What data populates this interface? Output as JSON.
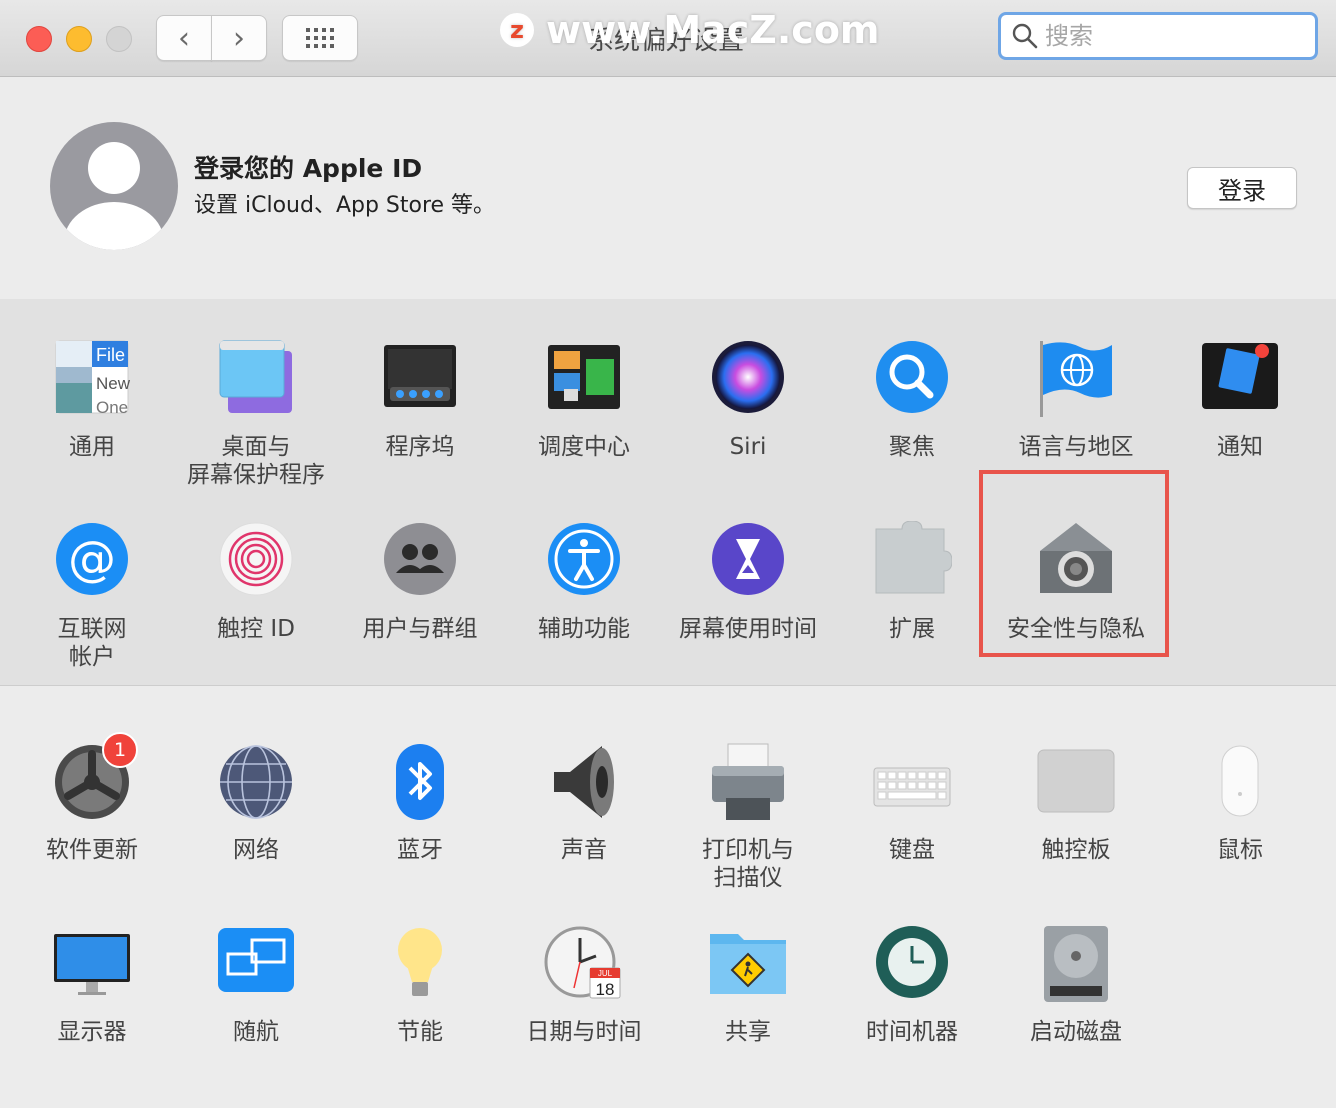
{
  "window": {
    "title": "系统偏好设置",
    "watermark": "www.MacZ.com",
    "watermark_logo": "z"
  },
  "search": {
    "placeholder": "搜索"
  },
  "account": {
    "title": "登录您的 Apple ID",
    "subtitle": "设置 iCloud、App Store 等。",
    "login_label": "登录"
  },
  "pane1": [
    {
      "label": "通用",
      "icon": "general-icon"
    },
    {
      "label": "桌面与",
      "label2": "屏幕保护程序",
      "icon": "desktop-icon"
    },
    {
      "label": "程序坞",
      "icon": "dock-icon"
    },
    {
      "label": "调度中心",
      "icon": "mission-control-icon"
    },
    {
      "label": "Siri",
      "icon": "siri-icon"
    },
    {
      "label": "聚焦",
      "icon": "spotlight-icon"
    },
    {
      "label": "语言与地区",
      "icon": "language-icon"
    },
    {
      "label": "通知",
      "icon": "notifications-icon"
    },
    {
      "label": "互联网",
      "label2": "帐户",
      "icon": "internet-accounts-icon"
    },
    {
      "label": "触控 ID",
      "icon": "touch-id-icon"
    },
    {
      "label": "用户与群组",
      "icon": "users-icon"
    },
    {
      "label": "辅助功能",
      "icon": "accessibility-icon"
    },
    {
      "label": "屏幕使用时间",
      "icon": "screen-time-icon"
    },
    {
      "label": "扩展",
      "icon": "extensions-icon"
    },
    {
      "label": "安全性与隐私",
      "icon": "security-icon"
    }
  ],
  "pane2": [
    {
      "label": "软件更新",
      "icon": "software-update-icon",
      "badge": "1"
    },
    {
      "label": "网络",
      "icon": "network-icon"
    },
    {
      "label": "蓝牙",
      "icon": "bluetooth-icon"
    },
    {
      "label": "声音",
      "icon": "sound-icon"
    },
    {
      "label": "打印机与",
      "label2": "扫描仪",
      "icon": "printer-icon"
    },
    {
      "label": "键盘",
      "icon": "keyboard-icon"
    },
    {
      "label": "触控板",
      "icon": "trackpad-icon"
    },
    {
      "label": "鼠标",
      "icon": "mouse-icon"
    },
    {
      "label": "显示器",
      "icon": "displays-icon"
    },
    {
      "label": "随航",
      "icon": "sidecar-icon"
    },
    {
      "label": "节能",
      "icon": "energy-saver-icon"
    },
    {
      "label": "日期与时间",
      "icon": "date-time-icon",
      "date_month": "JUL",
      "date_day": "18"
    },
    {
      "label": "共享",
      "icon": "sharing-icon"
    },
    {
      "label": "时间机器",
      "icon": "time-machine-icon"
    },
    {
      "label": "启动磁盘",
      "icon": "startup-disk-icon"
    }
  ],
  "general_icon_text": {
    "line1": "File",
    "line2": "New",
    "line3": "One"
  }
}
